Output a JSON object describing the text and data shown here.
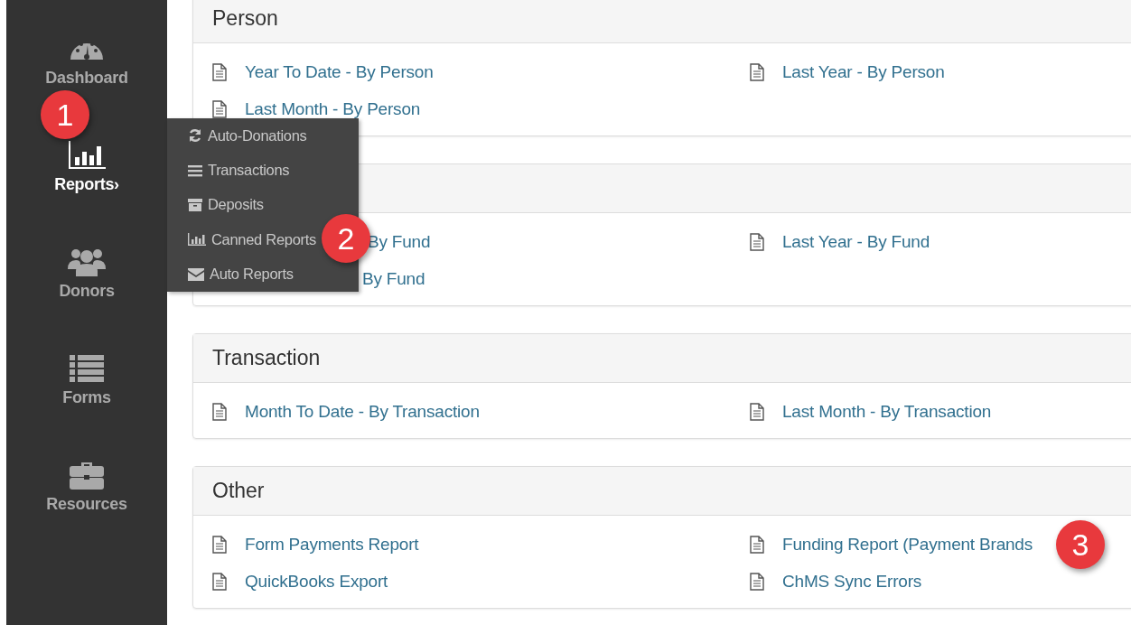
{
  "sidebar": {
    "items": [
      {
        "label": "Dashboard",
        "selected": false
      },
      {
        "label": "Reports",
        "selected": true,
        "chevron": "›"
      },
      {
        "label": "Donors",
        "selected": false
      },
      {
        "label": "Forms",
        "selected": false
      },
      {
        "label": "Resources",
        "selected": false
      }
    ]
  },
  "flyout_menu": {
    "items": [
      "Auto-Donations",
      "Transactions",
      "Deposits",
      "Canned Reports",
      "Auto Reports"
    ]
  },
  "panels": [
    {
      "title": "Person",
      "rows": [
        [
          {
            "label": "Year To Date - By Person",
            "icon": true
          },
          {
            "label": "Last Year - By Person",
            "icon": true
          }
        ],
        [
          {
            "label": "Last Month - By Person",
            "icon": true
          }
        ]
      ]
    },
    {
      "rows": [
        [
          {
            "label": "By Fund",
            "icon": false
          },
          {
            "label": "Last Year - By Fund",
            "icon": true
          }
        ],
        [
          {
            "label": "By Fund",
            "icon": false
          }
        ]
      ]
    },
    {
      "title": "Transaction",
      "rows": [
        [
          {
            "label": "Month To Date - By Transaction",
            "icon": true
          },
          {
            "label": "Last Month - By Transaction",
            "icon": true
          }
        ]
      ]
    },
    {
      "title": "Other",
      "rows": [
        [
          {
            "label": "Form Payments Report",
            "icon": true
          },
          {
            "label": "Funding Report (Payment Brands",
            "icon": true
          }
        ],
        [
          {
            "label": "QuickBooks Export",
            "icon": true
          },
          {
            "label": "ChMS Sync Errors",
            "icon": true
          }
        ]
      ]
    }
  ],
  "callouts": [
    "1",
    "2",
    "3"
  ]
}
